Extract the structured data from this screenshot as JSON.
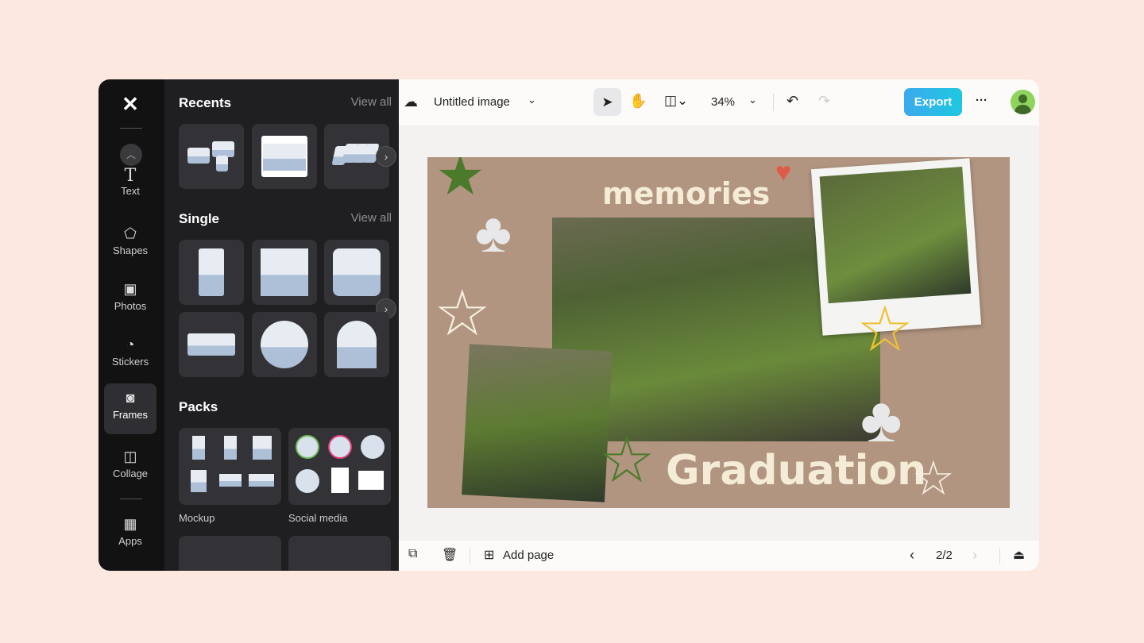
{
  "rail": {
    "items": [
      {
        "label": "Text",
        "icon": "T"
      },
      {
        "label": "Shapes",
        "icon": "⬠"
      },
      {
        "label": "Photos",
        "icon": "▣"
      },
      {
        "label": "Stickers",
        "icon": "◔"
      },
      {
        "label": "Frames",
        "icon": "◙"
      },
      {
        "label": "Collage",
        "icon": "◫"
      },
      {
        "label": "Apps",
        "icon": "▦"
      }
    ],
    "active": "Frames"
  },
  "panel": {
    "recents_title": "Recents",
    "single_title": "Single",
    "packs_title": "Packs",
    "view_all": "View all",
    "packs": [
      {
        "label": "Mockup"
      },
      {
        "label": "Social media"
      }
    ]
  },
  "topbar": {
    "title": "Untitled image",
    "zoom": "34%",
    "export_label": "Export",
    "more": "···"
  },
  "canvas": {
    "text_top": "memories",
    "text_bottom": "Graduation"
  },
  "bottombar": {
    "add_page": "Add page",
    "page_indicator": "2/2"
  },
  "colors": {
    "accent": "#1ec8e0",
    "panel": "#1f1e21",
    "canvas_bg": "#b19580"
  }
}
